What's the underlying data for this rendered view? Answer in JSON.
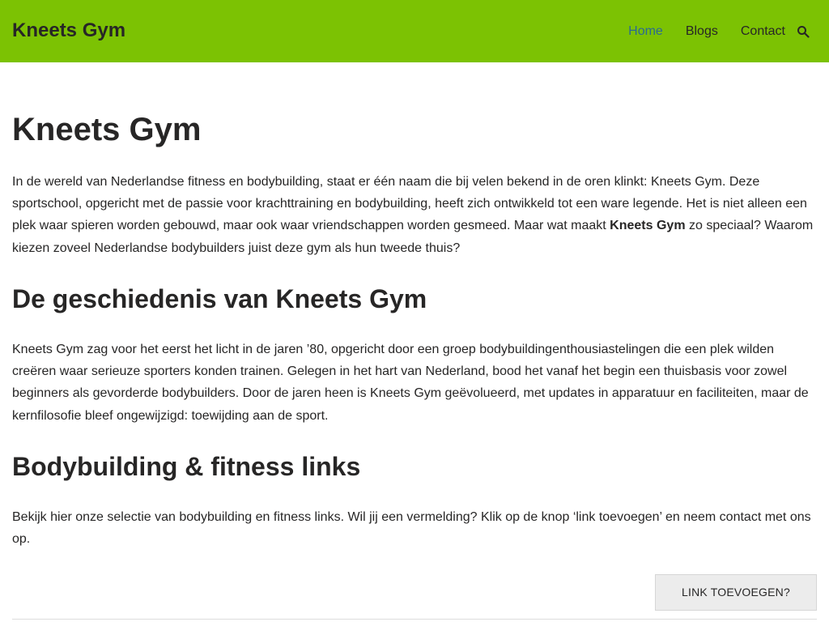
{
  "header": {
    "brand": "Kneets Gym",
    "nav": [
      {
        "label": "Home",
        "active": true
      },
      {
        "label": "Blogs"
      },
      {
        "label": "Contact"
      }
    ],
    "search_icon": "search-icon",
    "background_color": "#7cc203",
    "active_link_color": "#2b6a92"
  },
  "main": {
    "title": "Kneets Gym",
    "intro": {
      "before": "In de wereld van Nederlandse fitness en bodybuilding, staat er één naam die bij velen bekend in de oren klinkt: Kneets Gym. Deze sportschool, opgericht met de passie voor krachttraining en bodybuilding, heeft zich ontwikkeld tot een ware legende. Het is niet alleen een plek waar spieren worden gebouwd, maar ook waar vriendschappen worden gesmeed. Maar wat maakt ",
      "bold": "Kneets Gym",
      "after": " zo speciaal? Waarom kiezen zoveel Nederlandse bodybuilders juist deze gym als hun tweede thuis?"
    },
    "section1": {
      "heading": "De geschiedenis van Kneets Gym",
      "text": "Kneets Gym zag voor het eerst het licht in de jaren ’80, opgericht door een groep bodybuildingenthousiastelingen die een plek wilden creëren waar serieuze sporters konden trainen. Gelegen in het hart van Nederland, bood het vanaf het begin een thuisbasis voor zowel beginners als gevorderde bodybuilders. Door de jaren heen is Kneets Gym geëvolueerd, met updates in apparatuur en faciliteiten, maar de kernfilosofie bleef ongewijzigd: toewijding aan de sport."
    },
    "section2": {
      "heading": "Bodybuilding & fitness links",
      "text": "Bekijk hier onze selectie van bodybuilding en fitness links. Wil jij een vermelding? Klik op de knop ‘link toevoegen’ en neem contact met ons op."
    },
    "add_link_button": "LINK TOEVOEGEN?"
  }
}
